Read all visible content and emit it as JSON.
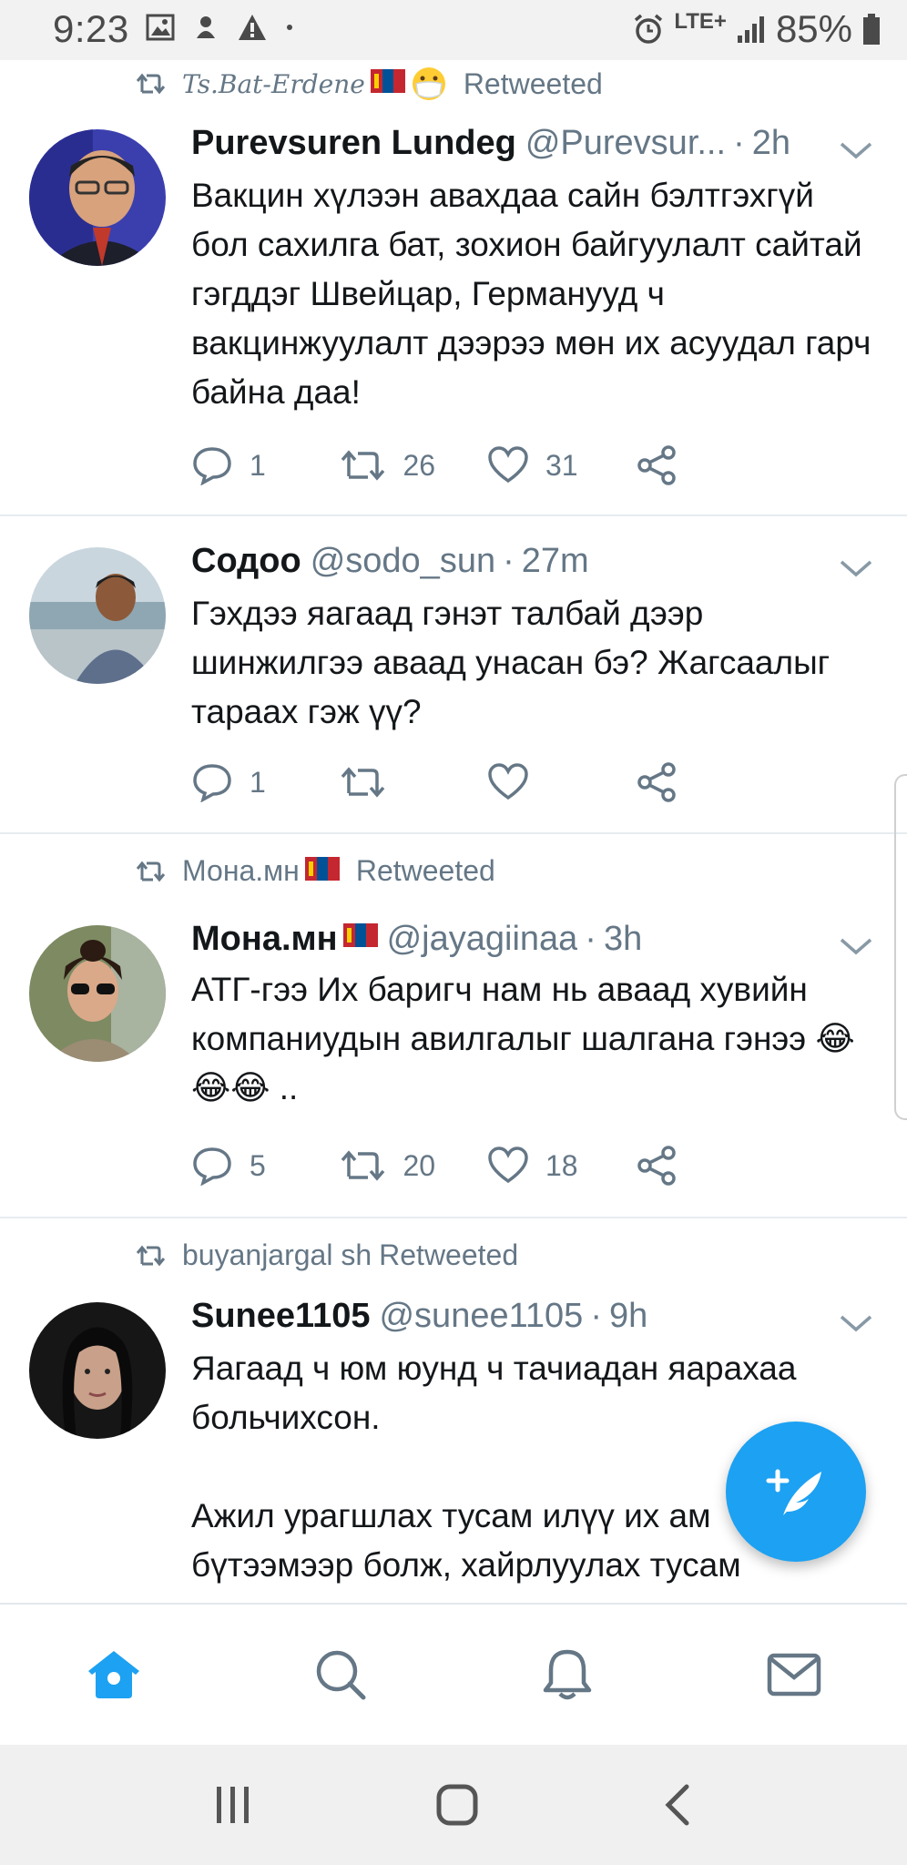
{
  "status_bar": {
    "time": "9:23",
    "network": "LTE+",
    "battery": "85%",
    "icons": [
      "image-icon",
      "notification-icon",
      "warning-icon",
      "dot-icon",
      "alarm-icon",
      "signal-icon",
      "battery-icon"
    ]
  },
  "tweets": [
    {
      "retweeted_by": "Ts.Bat-Erdene",
      "retweeted_label": "Retweeted",
      "name": "Purevsuren Lundeg",
      "handle": "@Purevsur...",
      "time": "2h",
      "text": "Вакцин хүлээн авахдаа сайн бэлтгэхгүй бол сахилга бат, зохион байгуулалт сайтай гэгддэг Швейцар, Германууд ч вакцинжуулалт дээрээ мөн их асуудал гарч байна даа!",
      "replies": "1",
      "retweets": "26",
      "likes": "31"
    },
    {
      "retweeted_by": "",
      "retweeted_label": "",
      "name": "Содоо",
      "handle": "@sodo_sun",
      "time": "27m",
      "text": "Гэхдээ яагаад гэнэт талбай дээр шинжилгээ аваад унасан бэ? Жагсаалыг тараах гэж үү?",
      "replies": "1",
      "retweets": "",
      "likes": ""
    },
    {
      "retweeted_by": "Мона.мн",
      "retweeted_label": "Retweeted",
      "name": "Мона.мн",
      "handle": "@jayagiinaa",
      "time": "3h",
      "text": "АТГ-гээ Их баригч нам нь аваад хувийн компаниудын авилгалыг шалгана гэнээ 😂😂😂 ..",
      "replies": "5",
      "retweets": "20",
      "likes": "18"
    },
    {
      "retweeted_by": "buyanjargal sh",
      "retweeted_label": "Retweeted",
      "name": "Sunee1105",
      "handle": "@sunee1105",
      "time": "9h",
      "text": "Яагаад ч юм юунд ч тачиадан яарахаа больчихсон.\n\nАжил урагшлах тусам илүү их ам бүтээмээр болж, хайрлуулах тусам",
      "replies": "",
      "retweets": "",
      "likes": ""
    }
  ],
  "tab_bar": [
    "home-icon",
    "search-icon",
    "notifications-icon",
    "messages-icon"
  ],
  "colors": {
    "accent": "#1da1f2",
    "text": "#14171a",
    "secondary": "#657786",
    "divider": "#e6ecf0"
  }
}
